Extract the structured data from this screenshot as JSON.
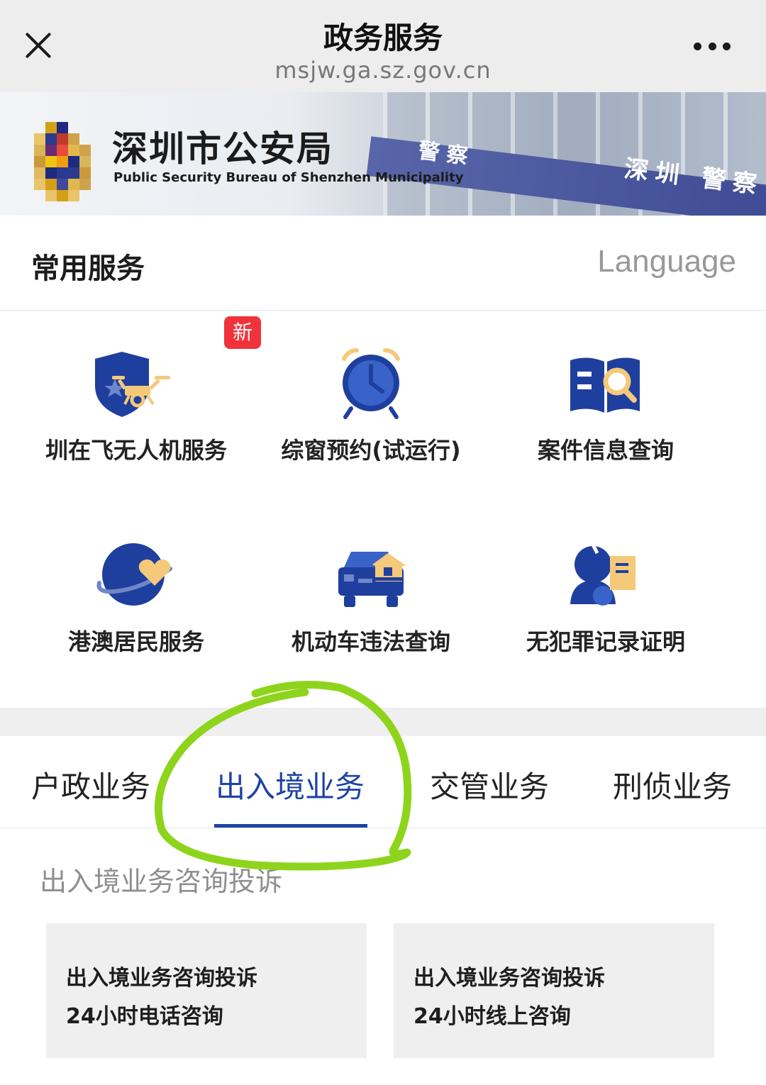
{
  "nav": {
    "title": "政务服务",
    "url": "msjw.ga.sz.gov.cn",
    "close_icon": "close-icon",
    "more_icon": "more-icon"
  },
  "banner": {
    "name_cn": "深圳市公安局",
    "name_en": "Public Security Bureau of Shenzhen Municipality",
    "stripe_text_1": "深圳",
    "stripe_text_2": "警察"
  },
  "services_header": {
    "title": "常用服务",
    "language": "Language"
  },
  "services": [
    {
      "label": "圳在飞无人机服务",
      "icon": "drone-shield-icon",
      "badge": "新"
    },
    {
      "label": "综窗预约(试运行)",
      "icon": "alarm-clock-icon"
    },
    {
      "label": "案件信息查询",
      "icon": "book-search-icon"
    },
    {
      "label": "港澳居民服务",
      "icon": "planet-heart-icon"
    },
    {
      "label": "机动车违法查询",
      "icon": "car-house-icon"
    },
    {
      "label": "无犯罪记录证明",
      "icon": "person-document-icon"
    }
  ],
  "tabs": [
    {
      "label": "户政业务",
      "active": false
    },
    {
      "label": "出入境业务",
      "active": true
    },
    {
      "label": "交管业务",
      "active": false
    },
    {
      "label": "刑侦业务",
      "active": false
    }
  ],
  "subsection_title": "出入境业务咨询投诉",
  "cards": [
    {
      "line1": "出入境业务咨询投诉",
      "line2": "24小时电话咨询"
    },
    {
      "line1": "出入境业务咨询投诉",
      "line2": "24小时线上咨询"
    }
  ],
  "colors": {
    "accent_blue": "#1d43a4",
    "icon_blue": "#1f3f9e",
    "icon_gold": "#f4c97a",
    "badge_red": "#f0333a",
    "annotation_green": "#8fd41c"
  }
}
